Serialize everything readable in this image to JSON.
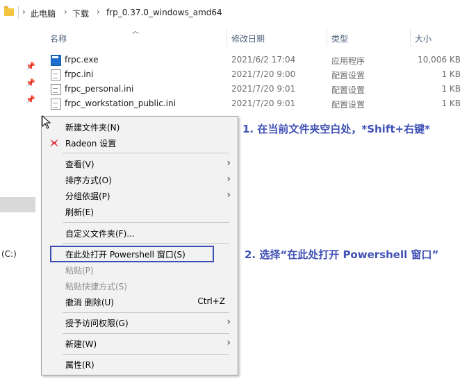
{
  "address": {
    "crumbs": [
      "此电脑",
      "下载",
      "frp_0.37.0_windows_amd64"
    ],
    "separator": "›"
  },
  "columns": {
    "name": "名称",
    "date": "修改日期",
    "type": "类型",
    "size": "大小"
  },
  "files": [
    {
      "name": "frpc.exe",
      "date": "2021/6/2 17:04",
      "type": "应用程序",
      "size": "10,006 KB",
      "icon": "exe-icon"
    },
    {
      "name": "frpc.ini",
      "date": "2021/7/20 9:00",
      "type": "配置设置",
      "size": "1 KB",
      "icon": "ini-file-icon"
    },
    {
      "name": "frpc_personal.ini",
      "date": "2021/7/20 9:01",
      "type": "配置设置",
      "size": "1 KB",
      "icon": "ini-file-icon"
    },
    {
      "name": "frpc_workstation_public.ini",
      "date": "2021/7/20 9:01",
      "type": "配置设置",
      "size": "1 KB",
      "icon": "ini-file-icon"
    }
  ],
  "nav": {
    "drive_label": "(C:)"
  },
  "menu": {
    "new_folder": "新建文件夹(N)",
    "radeon": "Radeon 设置",
    "view": "查看(V)",
    "sort": "排序方式(O)",
    "group": "分组依据(P)",
    "refresh": "刷新(E)",
    "customize": "自定义文件夹(F)...",
    "powershell": "在此处打开 Powershell 窗口(S)",
    "paste": "粘贴(P)",
    "paste_shortcut": "粘贴快捷方式(S)",
    "undo": "撤消 删除(U)",
    "undo_shortcut": "Ctrl+Z",
    "access": "授予访问权限(G)",
    "new": "新建(W)",
    "properties": "属性(R)"
  },
  "annotations": {
    "step1": "1. 在当前文件夹空白处，*Shift+右键*",
    "step2": "2. 选择“在此处打开 Powershell 窗口”"
  },
  "colors": {
    "annotation": "#3f51b5",
    "highlight_border": "#3c4eb3"
  }
}
